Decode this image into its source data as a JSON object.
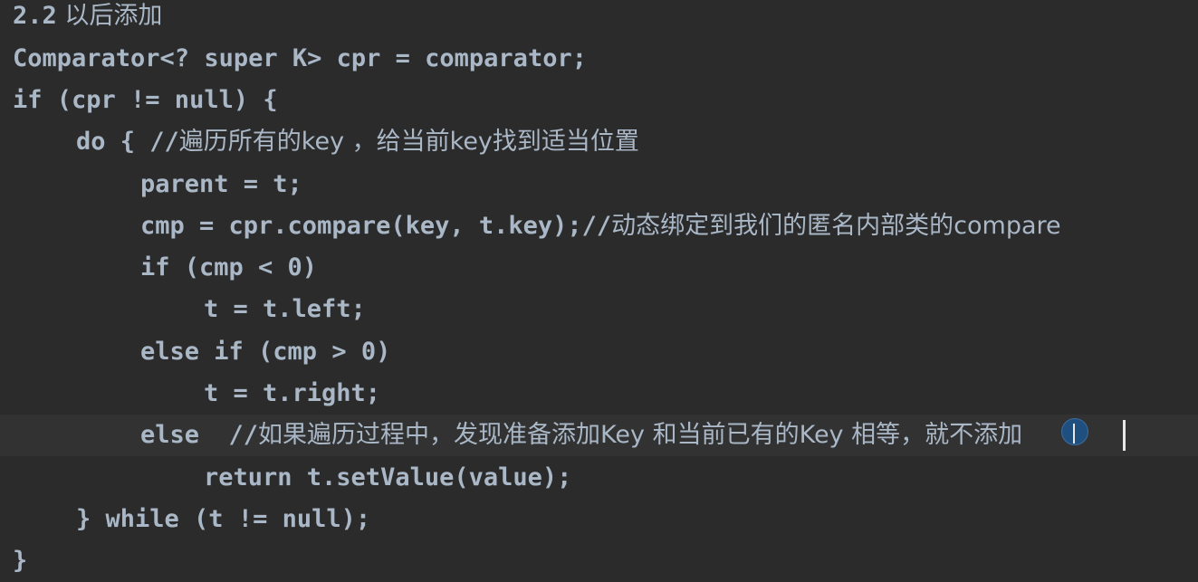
{
  "heading": {
    "number": "2.2",
    "title": " 以后添加"
  },
  "code": {
    "line1": "Comparator<? super K> cpr = comparator;",
    "line2": "if (cpr != null) {",
    "line3_code": "do { //",
    "line3_comment": "遍历所有的key ，给当前key找到适当位置",
    "line4": "parent = t;",
    "line5_code": "cmp = cpr.compare(key, t.key);//",
    "line5_comment": "动态绑定到我们的匿名内部类的compare",
    "line6": "if (cmp < 0)",
    "line7": "t = t.left;",
    "line8": "else if (cmp > 0)",
    "line9": "t = t.right;",
    "line10_code": "else  //",
    "line10_comment": "如果遍历过程中，发现准备添加Key 和当前已有的Key 相等，就不添加",
    "line11": "return t.setValue(value);",
    "line12": "} while (t != null);",
    "line13": "}"
  }
}
